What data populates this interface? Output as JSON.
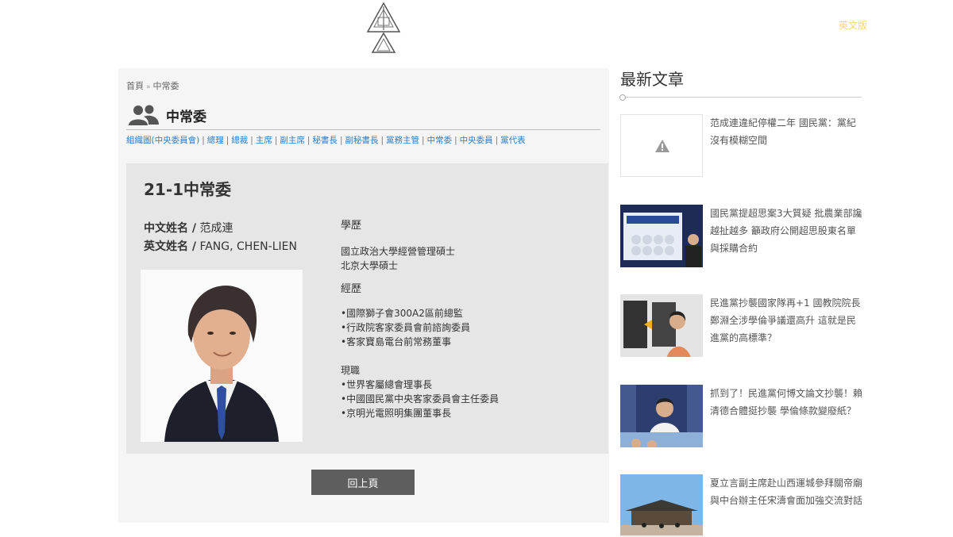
{
  "header": {
    "lang_link": "英文版"
  },
  "breadcrumb": {
    "home": "首頁",
    "separator": "»",
    "current": "中常委"
  },
  "section": {
    "title": "中常委",
    "icon": "users-icon"
  },
  "categories": [
    "組織圖(中央委員會)",
    "總理",
    "總裁",
    "主席",
    "副主席",
    "秘書長",
    "副秘書長",
    "黨務主管",
    "中常委",
    "中央委員",
    "黨代表"
  ],
  "card": {
    "title": "21-1中常委",
    "chinese_name_label": "中文姓名 /",
    "chinese_name": "范成連",
    "english_name_label": "英文姓名 /",
    "english_name": "FANG, CHEN-LIEN",
    "education_heading": "學歷",
    "education": [
      "國立政治大學經營管理碩士",
      "北京大學碩士"
    ],
    "experience_heading": "經歷",
    "experience": [
      "•國際獅子會300A2區前總監",
      "•行政院客家委員會前諮詢委員",
      "•客家寶島電台前常務董事"
    ],
    "current_heading": "現職",
    "current": [
      "•世界客屬總會理事長",
      "•中國國民黨中央客家委員會主任委員",
      "•京明光電照明集團董事長"
    ]
  },
  "back_button": "回上頁",
  "sidebar": {
    "title": "最新文章",
    "articles": [
      {
        "headline": "范成連違紀停權二年 國民黨：黨紀沒有模糊空間"
      },
      {
        "headline": "國民黨提超思案3大質疑 批農業部讒越扯越多 籲政府公開超思股東名單與採購合約"
      },
      {
        "headline": "民進黨抄襲國家隊再+1 國教院院長鄭淵全涉學倫爭議還高升 這就是民進黨的高標準？"
      },
      {
        "headline": "抓到了！民進黨何博文論文抄襲！賴清德合體挺抄襲 學倫條款變廢紙？"
      },
      {
        "headline": "夏立言副主席赴山西運城參拜關帝廟 與中台辦主任宋濤會面加強交流對話"
      }
    ]
  },
  "colors": {
    "link_blue": "#2d7cc7",
    "lang_link": "#f0d878",
    "button_bg": "#5e5e5e"
  }
}
